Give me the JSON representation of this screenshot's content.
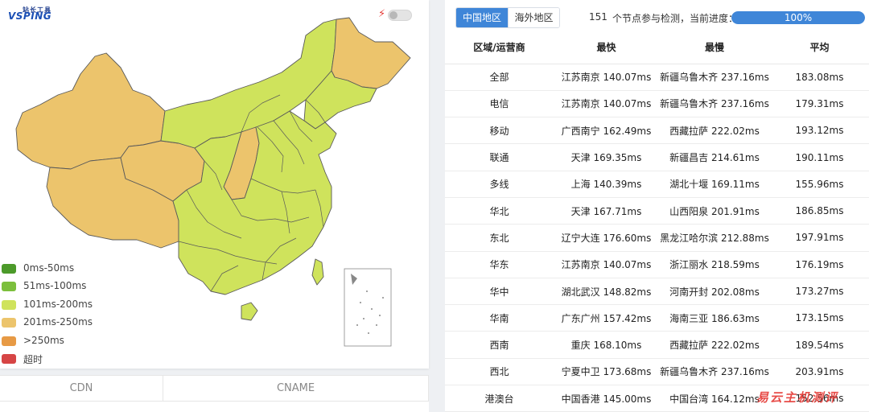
{
  "brand": {
    "top_text": "站长工具",
    "main_text": "VSPING"
  },
  "legend": [
    {
      "label": "0ms-50ms",
      "color": "#4c9a2a"
    },
    {
      "label": "51ms-100ms",
      "color": "#7cbf3c"
    },
    {
      "label": "101ms-200ms",
      "color": "#cfe35c"
    },
    {
      "label": "201ms-250ms",
      "color": "#ecc46c"
    },
    {
      "label": ">250ms",
      "color": "#e79a45"
    },
    {
      "label": "超时",
      "color": "#d64545"
    }
  ],
  "bottom_tabs": [
    "CDN",
    "CNAME"
  ],
  "region_tabs": [
    "中国地区",
    "海外地区"
  ],
  "status": {
    "count": "151",
    "label": "个节点参与检测，当前进度：",
    "progress_text": "100%",
    "progress_value": 1.0
  },
  "table": {
    "headers": [
      "区域/运营商",
      "最快",
      "最慢",
      "平均"
    ],
    "rows": [
      [
        "全部",
        "江苏南京 140.07ms",
        "新疆乌鲁木齐 237.16ms",
        "183.08ms"
      ],
      [
        "电信",
        "江苏南京 140.07ms",
        "新疆乌鲁木齐 237.16ms",
        "179.31ms"
      ],
      [
        "移动",
        "广西南宁 162.49ms",
        "西藏拉萨 222.02ms",
        "193.12ms"
      ],
      [
        "联通",
        "天津 169.35ms",
        "新疆昌吉 214.61ms",
        "190.11ms"
      ],
      [
        "多线",
        "上海 140.39ms",
        "湖北十堰 169.11ms",
        "155.96ms"
      ],
      [
        "华北",
        "天津 167.71ms",
        "山西阳泉 201.91ms",
        "186.85ms"
      ],
      [
        "东北",
        "辽宁大连 176.60ms",
        "黑龙江哈尔滨 212.88ms",
        "197.91ms"
      ],
      [
        "华东",
        "江苏南京 140.07ms",
        "浙江丽水 218.59ms",
        "176.19ms"
      ],
      [
        "华中",
        "湖北武汉 148.82ms",
        "河南开封 202.08ms",
        "173.27ms"
      ],
      [
        "华南",
        "广东广州 157.42ms",
        "海南三亚 186.63ms",
        "173.15ms"
      ],
      [
        "西南",
        "重庆 168.10ms",
        "西藏拉萨 222.02ms",
        "189.54ms"
      ],
      [
        "西北",
        "宁夏中卫 173.68ms",
        "新疆乌鲁木齐 237.16ms",
        "203.91ms"
      ],
      [
        "港澳台",
        "中国香港 145.00ms",
        "中国台湾 164.12ms",
        "152.56ms"
      ]
    ]
  },
  "watermark": "易云主机测评",
  "colors": {
    "map_green": "#cfe35c",
    "map_orange": "#ecc46c",
    "accent": "#3f86d8",
    "bolt": "#e53935"
  }
}
